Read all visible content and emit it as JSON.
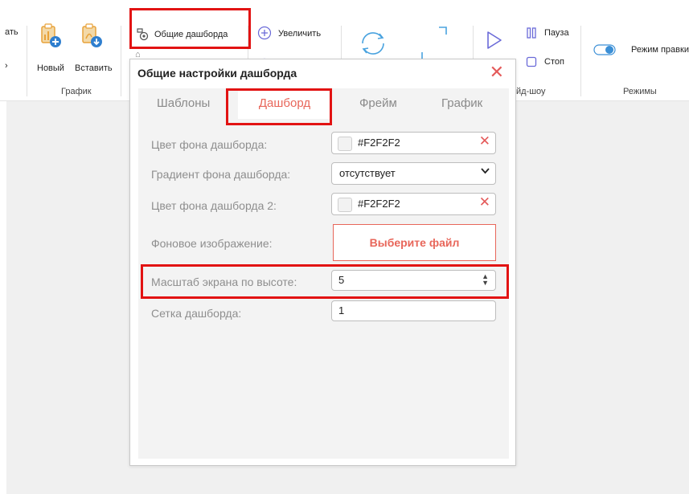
{
  "ribbon": {
    "partial_left_top": "ать",
    "partial_left_bottom": "›",
    "new_label": "Новый",
    "insert_label": "Вставить",
    "group_chart_label": "График",
    "general_dashboards_label": "Общие дашборда",
    "zoom_in_label": "Увеличить",
    "pause_label": "Пауза",
    "stop_label": "Стоп",
    "slideshow_group_label": "йд-шоу",
    "edit_mode_label": "Режим правки",
    "modes_group_label": "Режимы"
  },
  "dialog": {
    "title": "Общие настройки дашборда",
    "close_glyph": "✕",
    "tabs": [
      {
        "label": "Шаблоны"
      },
      {
        "label": "Дашборд"
      },
      {
        "label": "Фрейм"
      },
      {
        "label": "График"
      }
    ],
    "fields": {
      "bg_color_label": "Цвет фона дашборда:",
      "bg_color_value": "#F2F2F2",
      "gradient_label": "Градиент фона дашборда:",
      "gradient_value": "отсутствует",
      "bg_color2_label": "Цвет фона дашборда 2:",
      "bg_color2_value": "#F2F2F2",
      "bg_image_label": "Фоновое изображение:",
      "bg_image_button": "Выберите файл",
      "scale_label": "Масштаб экрана по высоте:",
      "scale_value": "5",
      "grid_label": "Сетка дашборда:",
      "grid_value": "1"
    }
  },
  "colors": {
    "accent": "#e8665a",
    "highlight_red": "#e21313",
    "icon_blue": "#2f7fcf",
    "icon_orange": "#e8a23a",
    "workspace_bg": "#f0f0f0"
  }
}
